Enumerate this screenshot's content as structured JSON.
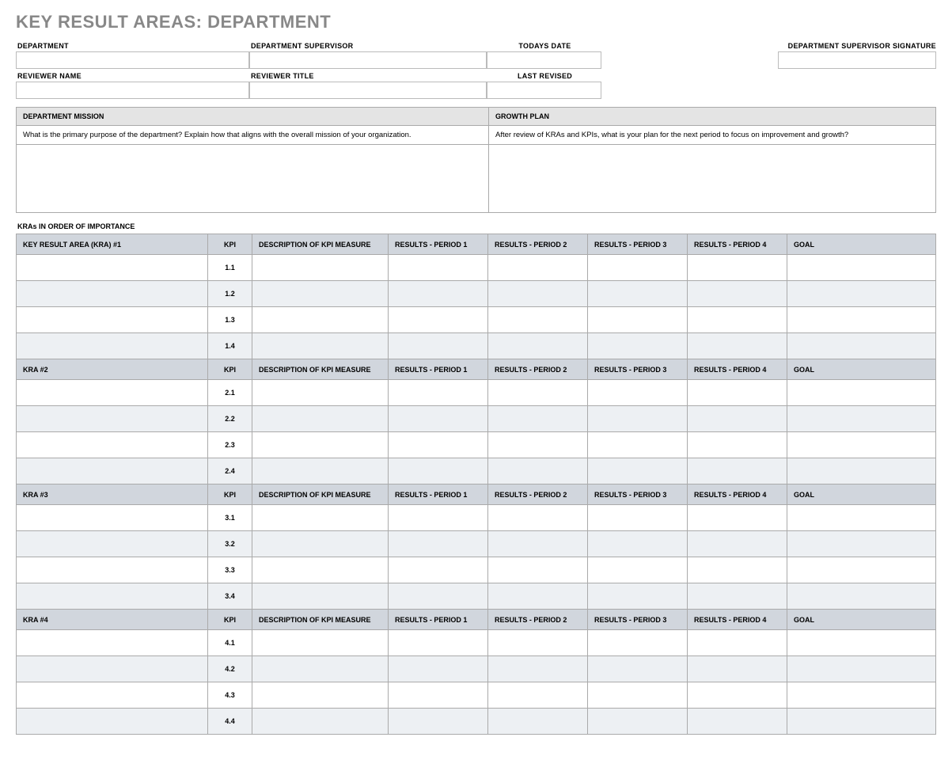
{
  "title": "KEY RESULT AREAS: DEPARTMENT",
  "info": {
    "department_label": "DEPARTMENT",
    "supervisor_label": "DEPARTMENT SUPERVISOR",
    "todays_date_label": "TODAYS DATE",
    "signature_label": "DEPARTMENT SUPERVISOR SIGNATURE",
    "reviewer_name_label": "REVIEWER NAME",
    "reviewer_title_label": "REVIEWER TITLE",
    "last_revised_label": "LAST REVISED"
  },
  "mission": {
    "header": "DEPARTMENT MISSION",
    "prompt": "What is the primary purpose of the department?  Explain how that aligns with the overall mission of your organization."
  },
  "growth": {
    "header": "GROWTH PLAN",
    "prompt": "After review of KRAs and KPIs, what is your plan for the next period to focus on improvement and growth?"
  },
  "kras_section_label": "KRAs IN ORDER OF IMPORTANCE",
  "col": {
    "kpi": "KPI",
    "desc": "DESCRIPTION OF KPI MEASURE",
    "p1": "RESULTS - PERIOD 1",
    "p2": "RESULTS - PERIOD 2",
    "p3": "RESULTS - PERIOD 3",
    "p4": "RESULTS - PERIOD 4",
    "goal": "GOAL"
  },
  "kra": [
    {
      "title": "KEY RESULT AREA (KRA) #1",
      "kpis": [
        "1.1",
        "1.2",
        "1.3",
        "1.4"
      ]
    },
    {
      "title": "KRA #2",
      "kpis": [
        "2.1",
        "2.2",
        "2.3",
        "2.4"
      ]
    },
    {
      "title": "KRA #3",
      "kpis": [
        "3.1",
        "3.2",
        "3.3",
        "3.4"
      ]
    },
    {
      "title": "KRA #4",
      "kpis": [
        "4.1",
        "4.2",
        "4.3",
        "4.4"
      ]
    }
  ]
}
